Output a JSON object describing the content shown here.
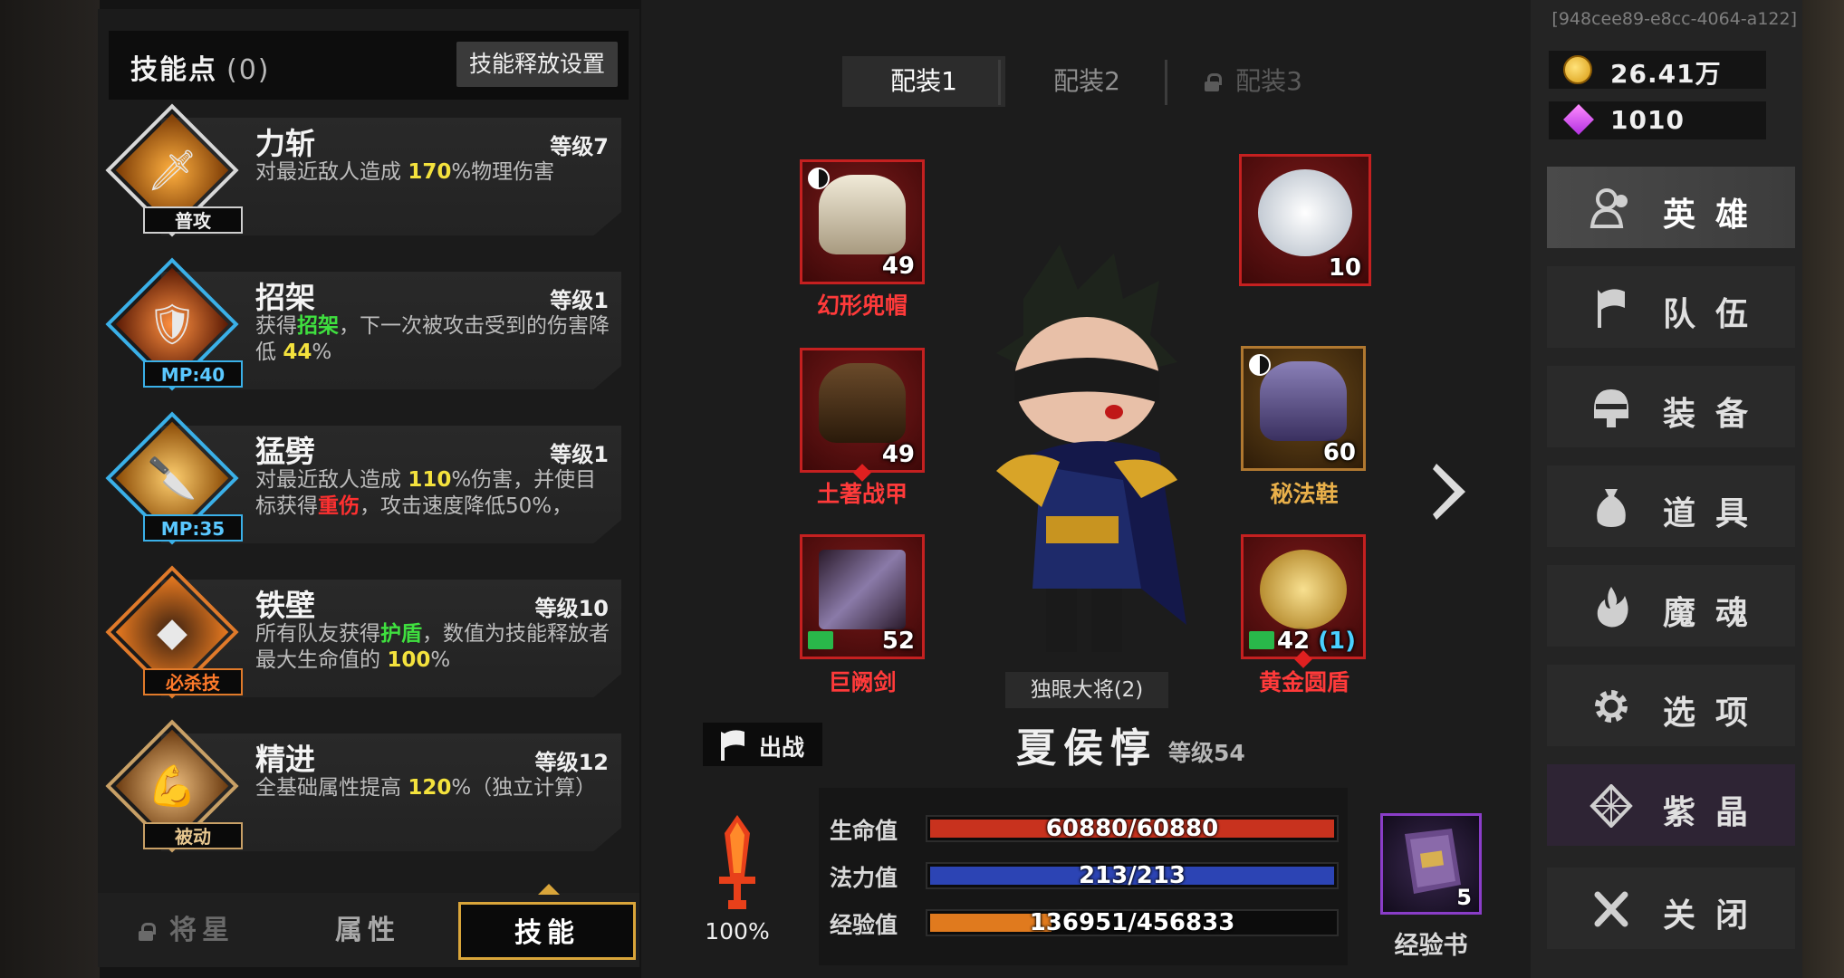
{
  "uid": "[948cee89-e8cc-4064-a122]",
  "skills_panel": {
    "title": "技能点",
    "points": "(0)",
    "release_settings": "技能释放设置",
    "skills": [
      {
        "name": "力斩",
        "level": "等级7",
        "desc": [
          "对最近敌人造成 ",
          "170",
          "%物理伤害"
        ],
        "tag": "普攻"
      },
      {
        "name": "招架",
        "level": "等级1",
        "desc": [
          "获得",
          "招架",
          "，下一次被攻击受到的伤害降低 ",
          "44",
          "%"
        ],
        "tag": "MP:40"
      },
      {
        "name": "猛劈",
        "level": "等级1",
        "desc": [
          "对最近敌人造成 ",
          "110",
          "%伤害，并使目标获得",
          "重伤",
          "，攻击速度降低50%，"
        ],
        "tag": "MP:35"
      },
      {
        "name": "铁壁",
        "level": "等级10",
        "desc": [
          "所有队友获得",
          "护盾",
          "，数值为技能释放者最大生命值的 ",
          "100",
          "%"
        ],
        "tag": "必杀技"
      },
      {
        "name": "精进",
        "level": "等级12",
        "desc": [
          "全基础属性提高 ",
          "120",
          "%（独立计算）"
        ],
        "tag": "被动"
      }
    ],
    "bottom_tabs": [
      "将星",
      "属性",
      "技能"
    ]
  },
  "loadout_tabs": [
    "配装1",
    "配装2",
    "配装3"
  ],
  "equipment": {
    "helmet": {
      "name": "幻形兜帽",
      "level": "49"
    },
    "pet": {
      "level": "10"
    },
    "armor": {
      "name": "土著战甲",
      "level": "49"
    },
    "boots": {
      "name": "秘法鞋",
      "level": "60"
    },
    "weapon": {
      "name": "巨阙剑",
      "level": "52"
    },
    "shield": {
      "name": "黄金圆盾",
      "level": "42",
      "extra": "(1)"
    }
  },
  "hero": {
    "title": "独眼大将(2)",
    "name": "夏侯惇",
    "level": "等级54",
    "sortie": "出战",
    "power_pct": "100%"
  },
  "stats": {
    "hp": {
      "label": "生命值",
      "value": "60880/60880",
      "ratio": 1.0,
      "color": "#c8321e"
    },
    "mp": {
      "label": "法力值",
      "value": "213/213",
      "ratio": 1.0,
      "color": "#2c44b4"
    },
    "exp": {
      "label": "经验值",
      "value": "136951/456833",
      "ratio": 0.2998,
      "color": "#e07a1e"
    }
  },
  "exp_book": {
    "label": "经验书",
    "count": "5"
  },
  "currency": {
    "gold": "26.41万",
    "gems": "1010"
  },
  "nav": [
    "英雄",
    "队伍",
    "装备",
    "道具",
    "魔魂",
    "选项",
    "紫晶",
    "关闭"
  ]
}
